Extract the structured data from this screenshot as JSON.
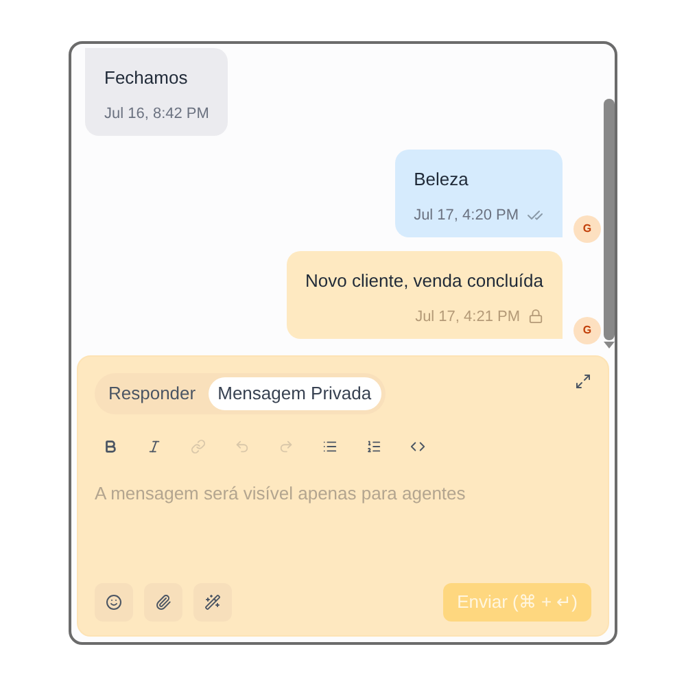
{
  "messages": [
    {
      "kind": "incoming",
      "text": "Fechamos",
      "time": "Jul 16, 8:42 PM"
    },
    {
      "kind": "outgoing",
      "text": "Beleza",
      "time": "Jul 17, 4:20 PM",
      "read": true,
      "avatar": "G"
    },
    {
      "kind": "private",
      "text": "Novo cliente, venda concluída",
      "time": "Jul 17, 4:21 PM",
      "avatar": "G"
    }
  ],
  "composer": {
    "tabs": [
      {
        "label": "Responder",
        "selected": false
      },
      {
        "label": "Mensagem Privada",
        "selected": true
      }
    ],
    "toolbar": [
      {
        "kind": "bold",
        "disabled": false
      },
      {
        "kind": "italic",
        "disabled": false
      },
      {
        "kind": "link",
        "disabled": true
      },
      {
        "kind": "undo",
        "disabled": true
      },
      {
        "kind": "redo",
        "disabled": true
      },
      {
        "kind": "bullets",
        "disabled": false
      },
      {
        "kind": "numbers",
        "disabled": false
      },
      {
        "kind": "code",
        "disabled": false
      }
    ],
    "placeholder": "A mensagem será visível apenas para agentes",
    "actions": [
      {
        "kind": "emoji"
      },
      {
        "kind": "attach"
      },
      {
        "kind": "magic"
      }
    ],
    "send": {
      "label": "Enviar (⌘ + ↵)",
      "disabled": true
    }
  }
}
